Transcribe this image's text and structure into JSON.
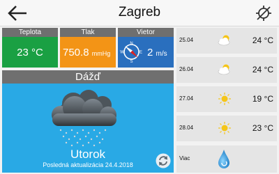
{
  "header": {
    "city": "Zagreb",
    "back_icon": "arrow-left-icon",
    "location_icon": "gps-off-icon"
  },
  "current": {
    "temperature": {
      "label": "Teplota",
      "value": "23 °C"
    },
    "pressure": {
      "label": "Tlak",
      "value": "750.8",
      "unit": "mmHg"
    },
    "wind": {
      "label": "Vietor",
      "value": "2",
      "unit": "m/s",
      "compass_letters": [
        "N",
        "E",
        "S",
        "W"
      ]
    },
    "condition": "Dážď",
    "day": "Utorok",
    "last_update": "Posledná aktualizácia 24.4.2018"
  },
  "forecast": [
    {
      "date": "25.04",
      "icon": "partly-cloudy-icon",
      "temp": "24 °C"
    },
    {
      "date": "26.04",
      "icon": "partly-cloudy-icon",
      "temp": "24 °C"
    },
    {
      "date": "27.04",
      "icon": "sun-icon",
      "temp": "19 °C"
    },
    {
      "date": "28.04",
      "icon": "sun-icon",
      "temp": "23 °C"
    }
  ],
  "more": {
    "label": "Viac",
    "icon": "water-drop-icon"
  },
  "colors": {
    "temperature_tile": "#1aa043",
    "pressure_tile": "#f39416",
    "wind_tile": "#2a6fbe",
    "condition_panel": "#29a9e5",
    "tile_header": "#6f6f6f"
  }
}
